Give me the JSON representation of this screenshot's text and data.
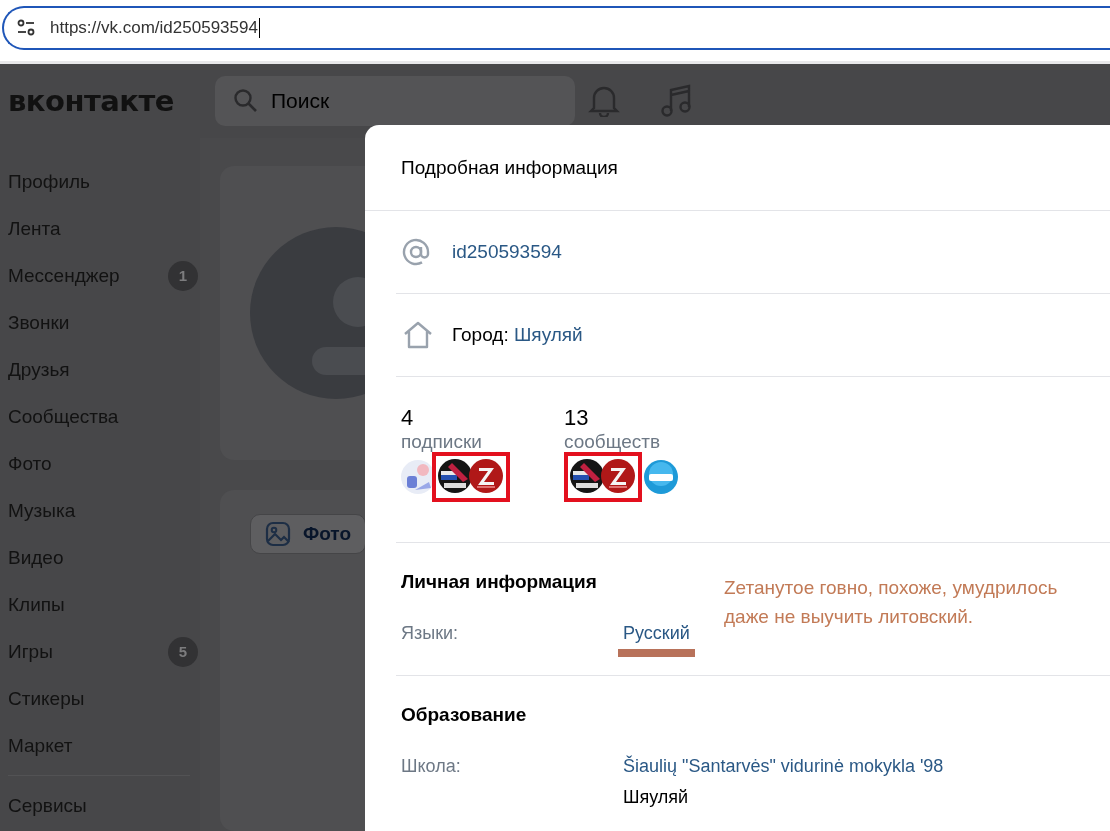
{
  "address_bar": {
    "url": "https://vk.com/id250593594"
  },
  "header": {
    "logo": "вконтакте",
    "search": {
      "placeholder": "Поиск"
    }
  },
  "sidebar": {
    "items": [
      {
        "label": "Профиль"
      },
      {
        "label": "Лента"
      },
      {
        "label": "Мессенджер",
        "badge": "1"
      },
      {
        "label": "Звонки"
      },
      {
        "label": "Друзья"
      },
      {
        "label": "Сообщества"
      },
      {
        "label": "Фото"
      },
      {
        "label": "Музыка"
      },
      {
        "label": "Видео"
      },
      {
        "label": "Клипы"
      },
      {
        "label": "Игры",
        "badge": "5"
      },
      {
        "label": "Стикеры"
      },
      {
        "label": "Маркет"
      }
    ],
    "footer_items": [
      {
        "label": "Сервисы"
      }
    ]
  },
  "profile": {
    "photo_button": "Фото"
  },
  "modal": {
    "title": "Подробная информация",
    "handle": "id250593594",
    "city": {
      "label": "Город:",
      "value": "Шяуляй"
    },
    "counters": [
      {
        "count": "4",
        "label": "подписки",
        "avatars": [
          {
            "kind": "picture",
            "highlighted": false
          },
          {
            "kind": "picture",
            "highlighted": true
          },
          {
            "kind": "picture",
            "highlighted": true
          }
        ]
      },
      {
        "count": "13",
        "label": "сообществ",
        "avatars": [
          {
            "kind": "picture",
            "highlighted": true
          },
          {
            "kind": "picture",
            "highlighted": true
          },
          {
            "kind": "picture",
            "highlighted": false
          }
        ]
      }
    ],
    "sections": [
      {
        "title": "Личная информация",
        "rows": [
          {
            "label": "Языки:",
            "values": [
              {
                "text": "Русский",
                "link": true,
                "underlined": true
              }
            ]
          }
        ]
      },
      {
        "title": "Образование",
        "rows": [
          {
            "label": "Школа:",
            "values": [
              {
                "text": "Šiaulių \"Santarvės\" vidurinė mokykla '98",
                "link": true,
                "underlined": false
              },
              {
                "text": "Шяуляй",
                "link": false,
                "underlined": false
              }
            ]
          }
        ]
      }
    ]
  },
  "annotation": {
    "text": "Zетанутое говно, похоже, умудрилось даже не выучить литовский."
  }
}
